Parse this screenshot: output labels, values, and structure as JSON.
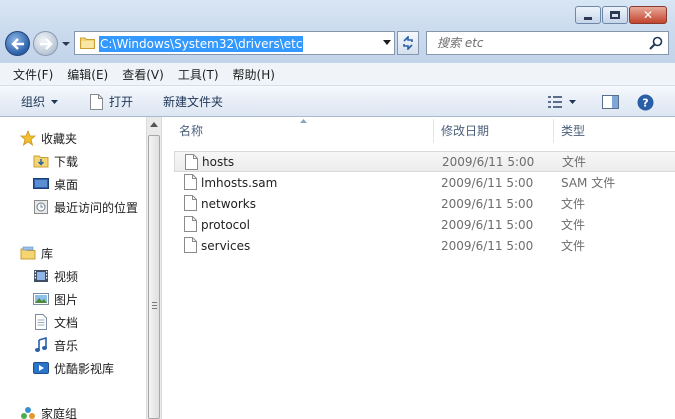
{
  "window": {
    "minimize_icon": "minimize-icon",
    "maximize_icon": "maximize-icon",
    "close_icon": "close-icon"
  },
  "address": {
    "path": "C:\\Windows\\System32\\drivers\\etc"
  },
  "search": {
    "placeholder": "搜索 etc"
  },
  "menu": [
    "文件(F)",
    "编辑(E)",
    "查看(V)",
    "工具(T)",
    "帮助(H)"
  ],
  "toolbar": {
    "organize": "组织",
    "open": "打开",
    "new_folder": "新建文件夹"
  },
  "nav": {
    "favorites": "收藏夹",
    "downloads": "下载",
    "desktop": "桌面",
    "recent": "最近访问的位置",
    "libraries": "库",
    "videos": "视频",
    "pictures": "图片",
    "documents": "文档",
    "music": "音乐",
    "youku": "优酷影视库",
    "homegroup": "家庭组"
  },
  "columns": {
    "name": "名称",
    "date": "修改日期",
    "type": "类型"
  },
  "files": [
    {
      "name": "hosts",
      "date": "2009/6/11 5:00",
      "type": "文件"
    },
    {
      "name": "lmhosts.sam",
      "date": "2009/6/11 5:00",
      "type": "SAM 文件"
    },
    {
      "name": "networks",
      "date": "2009/6/11 5:00",
      "type": "文件"
    },
    {
      "name": "protocol",
      "date": "2009/6/11 5:00",
      "type": "文件"
    },
    {
      "name": "services",
      "date": "2009/6/11 5:00",
      "type": "文件"
    }
  ],
  "colors": {
    "selection": "#3399ff",
    "header_text": "#4c607a",
    "muted_text": "#6d6d6d"
  }
}
